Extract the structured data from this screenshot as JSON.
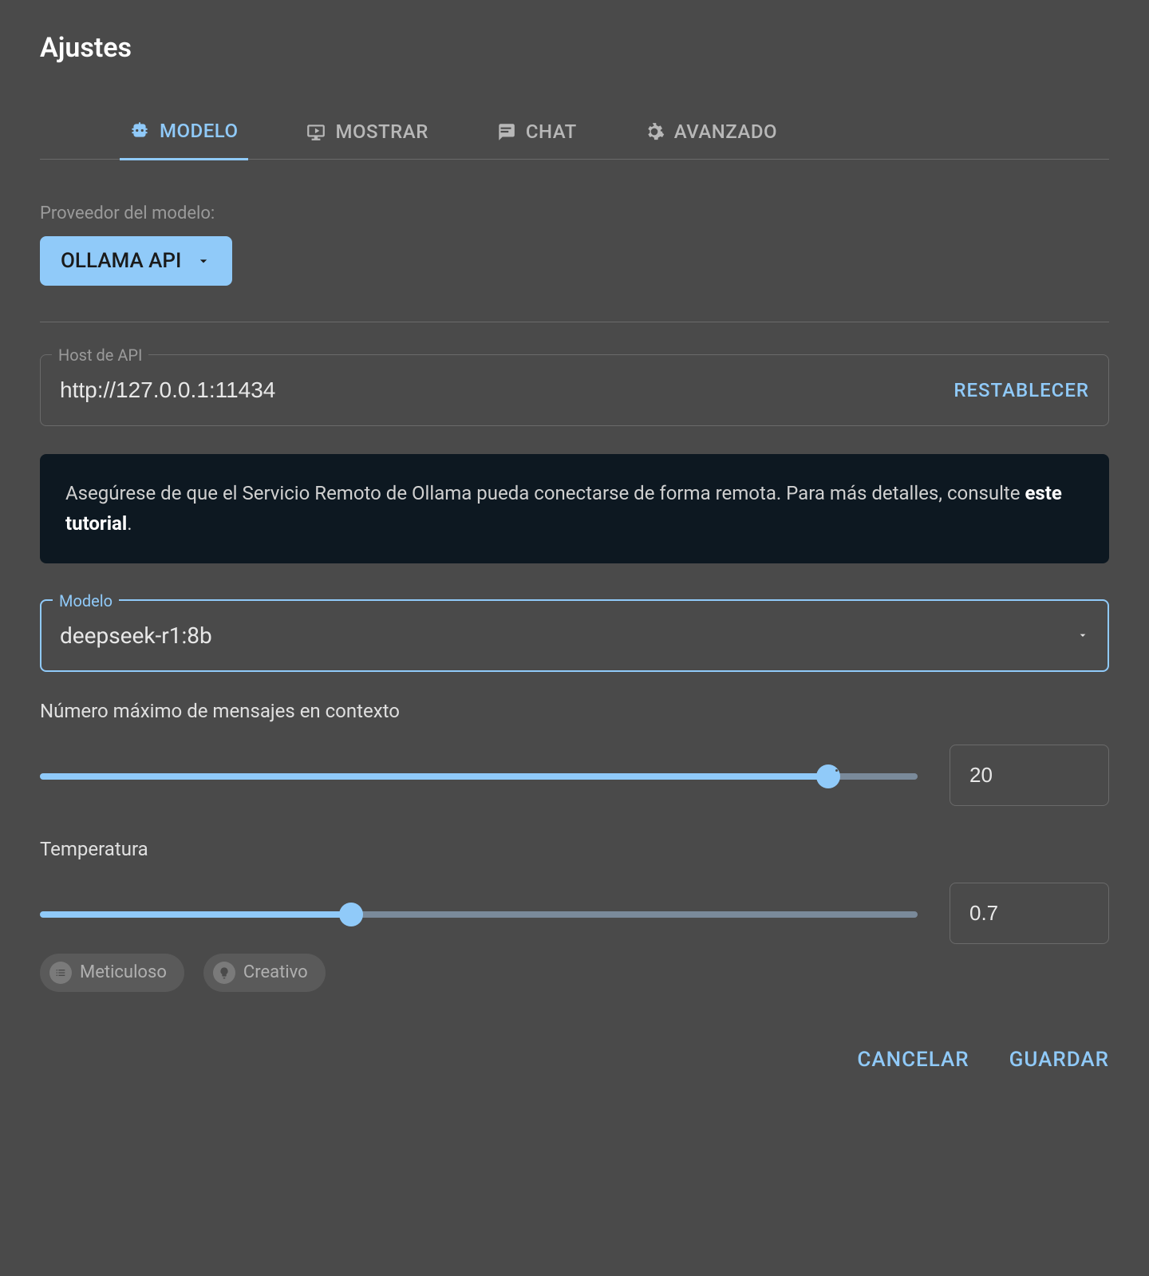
{
  "header": {
    "title": "Ajustes"
  },
  "tabs": {
    "items": [
      {
        "label": "MODELO"
      },
      {
        "label": "MOSTRAR"
      },
      {
        "label": "CHAT"
      },
      {
        "label": "AVANZADO"
      }
    ]
  },
  "provider": {
    "label": "Proveedor del modelo:",
    "value": "OLLAMA API"
  },
  "apiHost": {
    "legend": "Host de API",
    "value": "http://127.0.0.1:11434",
    "reset": "RESTABLECER"
  },
  "alert": {
    "text_prefix": "Asegúrese de que el Servicio Remoto de Ollama pueda conectarse de forma remota. Para más detalles, consulte ",
    "link": "este tutorial",
    "text_suffix": "."
  },
  "model": {
    "legend": "Modelo",
    "value": "deepseek-r1:8b"
  },
  "maxMessages": {
    "label": "Número máximo de mensajes en contexto",
    "value": "20"
  },
  "temperature": {
    "label": "Temperatura",
    "value": "0.7",
    "chips": [
      {
        "label": "Meticuloso"
      },
      {
        "label": "Creativo"
      }
    ]
  },
  "footer": {
    "cancel": "CANCELAR",
    "save": "GUARDAR"
  }
}
